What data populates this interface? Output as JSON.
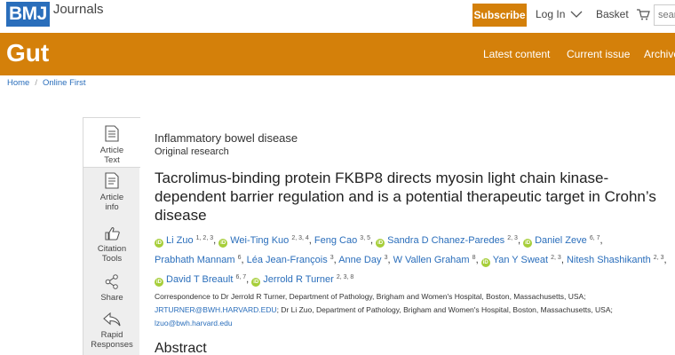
{
  "header": {
    "logo_mark": "BMJ",
    "logo_text": "Journals",
    "subscribe_label": "Subscribe",
    "login_label": "Log In",
    "basket_label": "Basket",
    "search_placeholder": "sear"
  },
  "journal_nav": {
    "title": "Gut",
    "items": [
      {
        "label": "Latest content"
      },
      {
        "label": "Current issue"
      },
      {
        "label": "Archive"
      }
    ]
  },
  "breadcrumb": {
    "items": [
      {
        "label": "Home"
      },
      {
        "label": "Online First"
      }
    ],
    "separator": "/"
  },
  "tools": [
    {
      "label": "Article Text",
      "icon": "document-icon",
      "active": true
    },
    {
      "label": "Article info",
      "icon": "info-icon",
      "active": false
    },
    {
      "label": "Citation Tools",
      "icon": "thumbs-up-icon",
      "active": false
    },
    {
      "label": "Share",
      "icon": "share-icon",
      "active": false
    },
    {
      "label": "Rapid Responses",
      "icon": "reply-icon",
      "active": false
    }
  ],
  "article": {
    "category": "Inflammatory bowel disease",
    "type": "Original research",
    "title": "Tacrolimus-binding protein FKBP8 directs myosin light chain kinase-dependent barrier regulation and is a potential therapeutic target in Crohn’s disease",
    "authors": [
      {
        "name": "Li Zuo",
        "affil": "1, 2, 3",
        "orcid": true
      },
      {
        "name": "Wei-Ting Kuo",
        "affil": "2, 3, 4",
        "orcid": true
      },
      {
        "name": "Feng Cao",
        "affil": "3, 5",
        "orcid": false
      },
      {
        "name": "Sandra D Chanez-Paredes",
        "affil": "2, 3",
        "orcid": true
      },
      {
        "name": "Daniel Zeve",
        "affil": "6, 7",
        "orcid": true
      },
      {
        "name": "Prabhath Mannam",
        "affil": "6",
        "orcid": false
      },
      {
        "name": "Léa Jean-François",
        "affil": "3",
        "orcid": false
      },
      {
        "name": "Anne Day",
        "affil": "3",
        "orcid": false
      },
      {
        "name": "W Vallen Graham",
        "affil": "8",
        "orcid": false
      },
      {
        "name": "Yan Y Sweat",
        "affil": "2, 3",
        "orcid": true
      },
      {
        "name": "Nitesh Shashikanth",
        "affil": "2, 3",
        "orcid": false
      },
      {
        "name": "David T Breault",
        "affil": "6, 7",
        "orcid": true
      },
      {
        "name": "Jerrold R Turner",
        "affil": "2, 3, 8",
        "orcid": true
      }
    ],
    "correspondence": {
      "part1": "Correspondence to Dr Jerrold R Turner, Department of Pathology, Brigham and Women's Hospital, Boston, Massachusetts, USA;",
      "email1": "JRTURNER@BWH.HARVARD.EDU",
      "part2": "; Dr Li Zuo, Department of Pathology, Brigham and Women's Hospital, Boston, Massachusetts, USA;",
      "email2": "lzuo@bwh.harvard.edu"
    },
    "abstract_heading": "Abstract"
  },
  "colors": {
    "brand_orange": "#d4800a",
    "bmj_blue": "#2a6ebb",
    "orcid_green": "#a6ce39"
  }
}
